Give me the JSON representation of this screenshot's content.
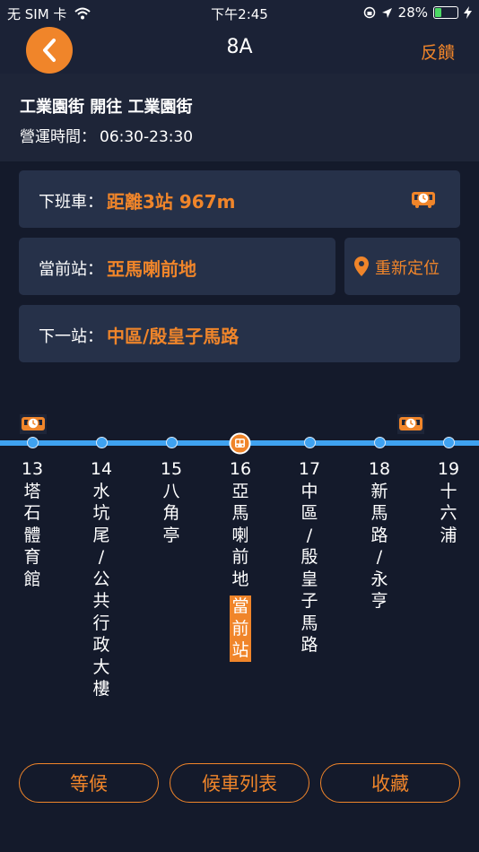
{
  "status_bar": {
    "carrier": "无 SIM 卡",
    "time": "下午2:45",
    "battery": "28%",
    "battery_level": 0.28
  },
  "nav": {
    "title": "8A",
    "feedback": "反饋"
  },
  "route": {
    "title": "工業園街 開往 工業園街",
    "hours_label": "營運時間：",
    "hours": "06:30-23:30"
  },
  "next_bus": {
    "label": "下班車：",
    "value": "距離3站 967m"
  },
  "current_stop": {
    "label": "當前站：",
    "value": "亞馬喇前地"
  },
  "relocate": {
    "label": "重新定位"
  },
  "next_stop": {
    "label": "下一站：",
    "value": "中區/殷皇子馬路"
  },
  "stops": [
    {
      "num": "13",
      "name": "塔石體育館"
    },
    {
      "num": "14",
      "name": "水坑尾/公共行政大樓"
    },
    {
      "num": "15",
      "name": "八角亭"
    },
    {
      "num": "16",
      "name": "亞馬喇前地"
    },
    {
      "num": "17",
      "name": "中區/殷皇子馬路"
    },
    {
      "num": "18",
      "name": "新馬路/永亨"
    },
    {
      "num": "19",
      "name": "十六浦"
    }
  ],
  "current_badge": "當前站",
  "buttons": {
    "wait": "等候",
    "list": "候車列表",
    "favorite": "收藏"
  },
  "colors": {
    "accent": "#f0852a",
    "line": "#3fa2f0",
    "background": "#141a2b",
    "card": "#263149"
  }
}
